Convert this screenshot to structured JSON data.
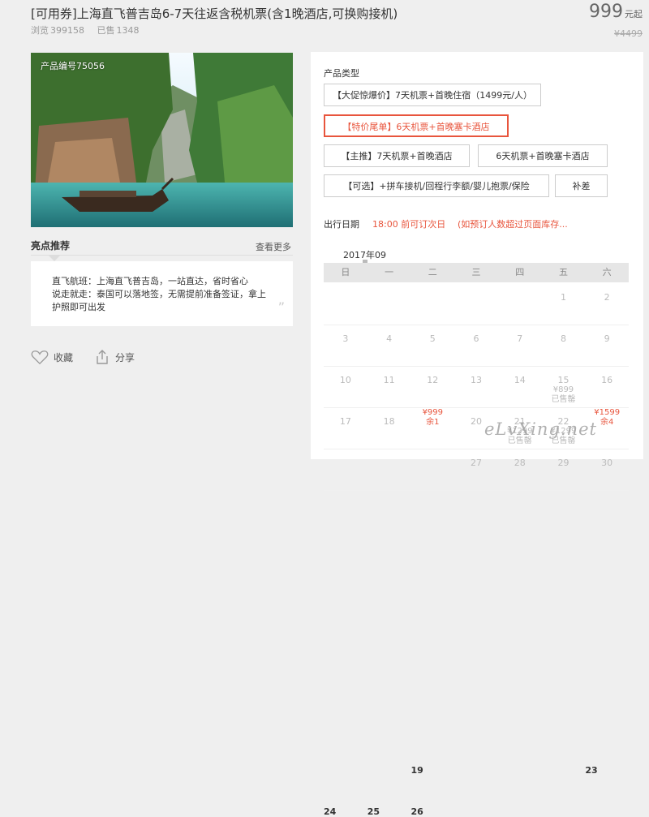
{
  "header": {
    "title": "[可用券]上海直飞普吉岛6-7天往返含税机票(含1晚酒店,可换购接机)",
    "views_label": "浏览",
    "views": "399158",
    "sold_label": "已售",
    "sold": "1348",
    "price": "999",
    "price_unit": "元起",
    "original_price": "¥4499"
  },
  "photo": {
    "product_code": "产品编号75056"
  },
  "highlights": {
    "title": "亮点推荐",
    "more": "查看更多",
    "line1": "直飞航班：上海直飞普吉岛，一站直达，省时省心",
    "line2": "说走就走：泰国可以落地签，无需提前准备签证，拿上护照即可出发",
    "quote": "”"
  },
  "actions": {
    "favorite": "收藏",
    "share": "分享"
  },
  "product_types": {
    "label": "产品类型",
    "options": [
      "【大促惊爆价】7天机票+首晚住宿（1499元/人）",
      "【特价尾单】6天机票+首晚塞卡酒店",
      "【主推】7天机票+首晚酒店",
      "6天机票+首晚塞卡酒店",
      "【可选】+拼车接机/回程行李额/婴儿抱票/保险",
      "补差"
    ],
    "selected_index": 1
  },
  "dates": {
    "label": "出行日期",
    "note1": "18:00 前可订次日",
    "note2": "(如预订人数超过页面库存...",
    "month": "2017年09",
    "weekdays": [
      "日",
      "一",
      "二",
      "三",
      "四",
      "五",
      "六"
    ],
    "rows": [
      [
        {
          "d": ""
        },
        {
          "d": ""
        },
        {
          "d": ""
        },
        {
          "d": ""
        },
        {
          "d": ""
        },
        {
          "d": "1"
        },
        {
          "d": "2"
        }
      ],
      [
        {
          "d": "3"
        },
        {
          "d": "4"
        },
        {
          "d": "5"
        },
        {
          "d": "6"
        },
        {
          "d": "7"
        },
        {
          "d": "8"
        },
        {
          "d": "9"
        }
      ],
      [
        {
          "d": "10"
        },
        {
          "d": "11"
        },
        {
          "d": "12"
        },
        {
          "d": "13"
        },
        {
          "d": "14"
        },
        {
          "d": "15",
          "p": "¥899",
          "s": "已售罄",
          "g": true
        },
        {
          "d": "16"
        }
      ],
      [
        {
          "d": "17"
        },
        {
          "d": "18"
        },
        {
          "d": "19",
          "p": "¥999",
          "s": "余1",
          "a": true
        },
        {
          "d": "20"
        },
        {
          "d": "21",
          "p": "¥1299",
          "s": "已售罄",
          "g": true
        },
        {
          "d": "22",
          "p": "¥1299",
          "s": "已售罄",
          "g": true
        },
        {
          "d": "23",
          "p": "¥1599",
          "s": "余4",
          "a": true
        }
      ],
      [
        {
          "d": "24",
          "a": true
        },
        {
          "d": "25",
          "a": true
        },
        {
          "d": "26",
          "a": true
        },
        {
          "d": "27"
        },
        {
          "d": "28"
        },
        {
          "d": "29"
        },
        {
          "d": "30"
        }
      ]
    ]
  },
  "watermark": "eLvXing.net",
  "colors": {
    "accent": "#e8553d",
    "weekday_bg": "#e6e6e6"
  }
}
